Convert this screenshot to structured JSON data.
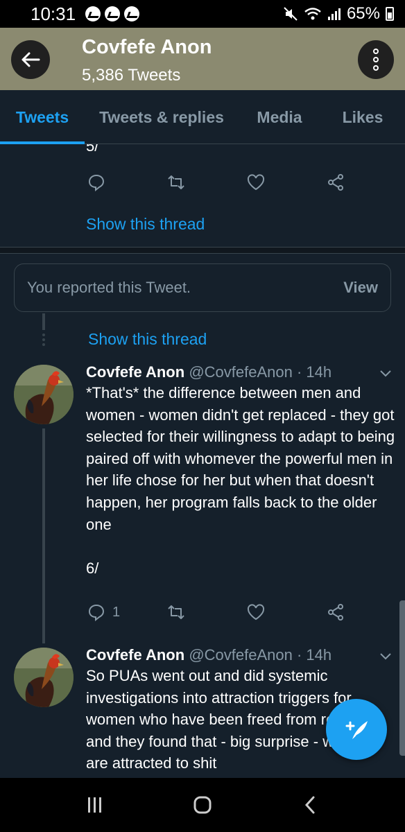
{
  "status_bar": {
    "time": "10:31",
    "battery": "65%"
  },
  "header": {
    "title": "Covfefe Anon",
    "subtitle": "5,386 Tweets"
  },
  "tabs": [
    {
      "label": "Tweets",
      "active": true
    },
    {
      "label": "Tweets & replies",
      "active": false
    },
    {
      "label": "Media",
      "active": false
    },
    {
      "label": "Likes",
      "active": false
    }
  ],
  "prev_tweet": {
    "cut_text": "5/",
    "show_thread": "Show this thread"
  },
  "reported": {
    "text": "You reported this Tweet.",
    "view": "View"
  },
  "thread_link": "Show this thread",
  "tweets": [
    {
      "name": "Covfefe Anon",
      "handle": "@CovfefeAnon",
      "time": "· 14h",
      "text": "*That's* the difference between men and women - women didn't get replaced - they got selected for their willingness to adapt to being paired off with whomever the powerful men in her life chose for her but when that doesn't happen, her program falls back to the older one\n\n6/",
      "reply_count": "1"
    },
    {
      "name": "Covfefe Anon",
      "handle": "@CovfefeAnon",
      "time": "· 14h",
      "text": "So PUAs went out and did systemic investigations into attraction triggers for women who have been freed from restraint and they found that - big surprise - women are attracted to shit"
    }
  ],
  "colors": {
    "background": "#15202b",
    "accent": "#1da1f2",
    "header": "#8b8a70",
    "muted": "#8899a6"
  },
  "icons": [
    "back-arrow-icon",
    "more-vertical-icon",
    "reply-icon",
    "retweet-icon",
    "like-icon",
    "share-icon",
    "chevron-down-icon",
    "compose-icon",
    "recent-apps-icon",
    "home-icon",
    "back-nav-icon"
  ]
}
